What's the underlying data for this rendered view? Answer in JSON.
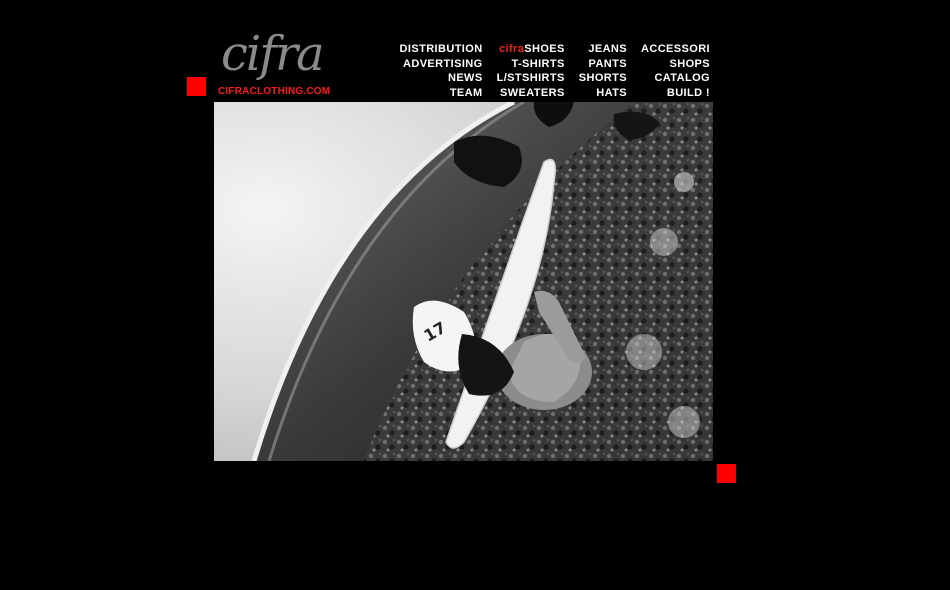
{
  "brand": {
    "logo_word": "cifra",
    "url_text": "CIFRACLOTHING.COM"
  },
  "nav": {
    "rows": [
      [
        {
          "label": "DISTRIBUTION"
        },
        {
          "prefix": "cifra",
          "label": "SHOES"
        },
        {
          "label": "JEANS"
        },
        {
          "label": "ACCESSORI"
        }
      ],
      [
        {
          "label": "ADVERTISING"
        },
        {
          "label": "T-SHIRTS"
        },
        {
          "label": "PANTS"
        },
        {
          "label": "SHOPS"
        }
      ],
      [
        {
          "label": "NEWS"
        },
        {
          "label": "L/STSHIRTS"
        },
        {
          "label": "SHORTS"
        },
        {
          "label": "CATALOG"
        }
      ],
      [
        {
          "label": "TEAM"
        },
        {
          "label": "SWEATERS"
        },
        {
          "label": "HATS"
        },
        {
          "label": "BUILD !"
        }
      ]
    ]
  },
  "colors": {
    "background": "#000000",
    "accent_red": "#ff0000",
    "nav_text": "#ffffff",
    "logo_gray": "#8a8a8a"
  },
  "photo": {
    "subject": "black-and-white surfer photo"
  }
}
